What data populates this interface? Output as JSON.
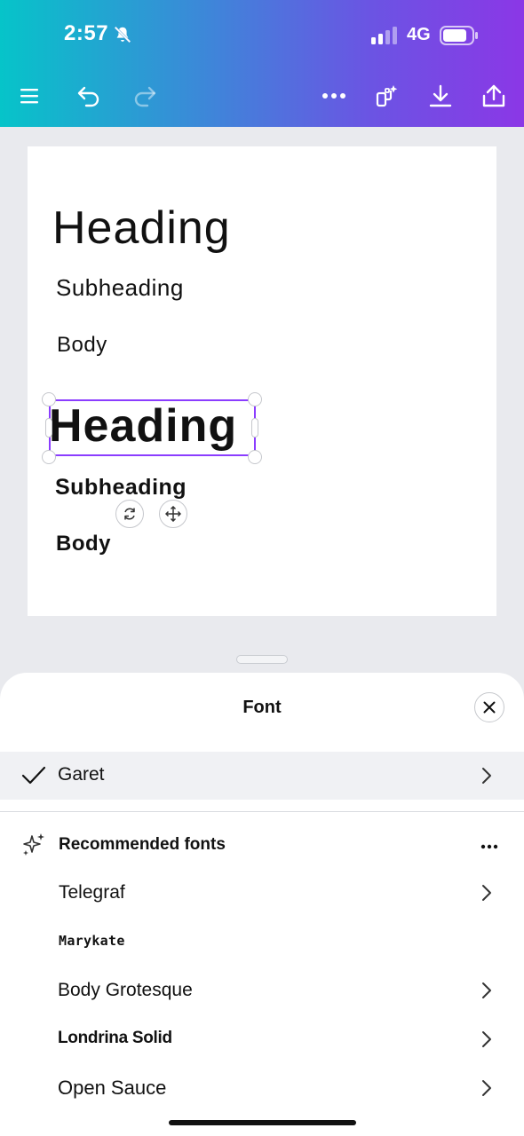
{
  "status_bar": {
    "time": "2:57",
    "network": "4G"
  },
  "canvas": {
    "heading_regular": "Heading",
    "subheading_regular": "Subheading",
    "body_regular": "Body",
    "heading_bold": "Heading",
    "subheading_bold": "Subheading",
    "body_bold": "Body"
  },
  "font_panel": {
    "title": "Font",
    "current_font": "Garet",
    "recommended_title": "Recommended fonts",
    "recommended": [
      {
        "label": "Telegraf",
        "has_chevron": true
      },
      {
        "label": "Marykate",
        "has_chevron": false
      },
      {
        "label": "Body Grotesque",
        "has_chevron": true
      },
      {
        "label": "Londrina Solid",
        "has_chevron": true
      },
      {
        "label": "Open Sauce",
        "has_chevron": true
      }
    ]
  },
  "colors": {
    "accent": "#8b3dff",
    "gradient_start": "#06c4c9",
    "gradient_end": "#8b37e6"
  }
}
